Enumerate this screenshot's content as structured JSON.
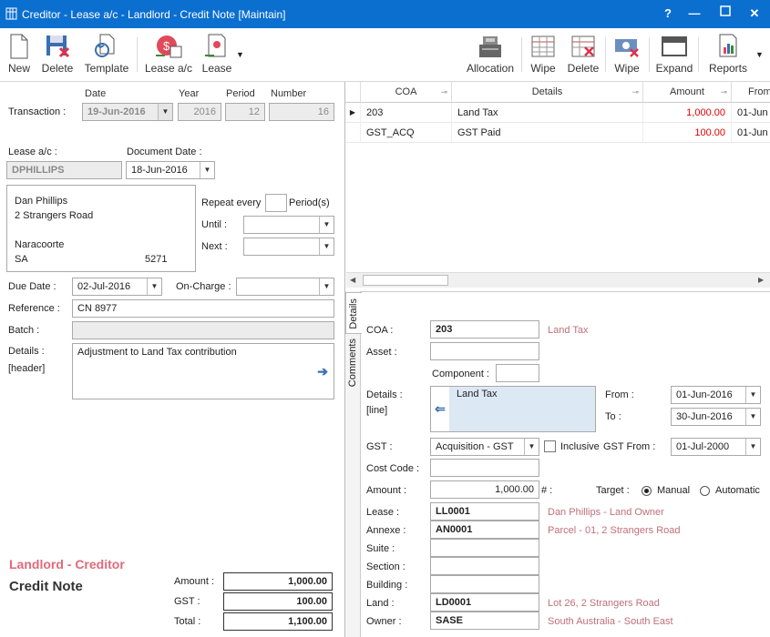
{
  "window": {
    "title": "Creditor - Lease a/c - Landlord - Credit Note [Maintain]",
    "help": "?"
  },
  "toolbar": {
    "new": "New",
    "delete": "Delete",
    "template": "Template",
    "lease_ac": "Lease a/c",
    "lease": "Lease",
    "allocation": "Allocation",
    "wipe1": "Wipe",
    "delete2": "Delete",
    "wipe2": "Wipe",
    "expand": "Expand",
    "reports": "Reports"
  },
  "transaction": {
    "label": "Transaction :",
    "date_hdr": "Date",
    "year_hdr": "Year",
    "period_hdr": "Period",
    "number_hdr": "Number",
    "date": "19-Jun-2016",
    "year": "2016",
    "period": "12",
    "number": "16"
  },
  "lease_ac": {
    "label": "Lease a/c :",
    "value": "DPHILLIPS"
  },
  "document_date": {
    "label": "Document Date :",
    "value": "18-Jun-2016"
  },
  "address": {
    "name": "Dan Phillips",
    "street": "2 Strangers Road",
    "town": "Naracoorte",
    "state": "SA",
    "postcode": "5271"
  },
  "repeat": {
    "label": "Repeat every",
    "unit": "Period(s)",
    "until_label": "Until :",
    "next_label": "Next :"
  },
  "due_date": {
    "label": "Due Date :",
    "value": "02-Jul-2016"
  },
  "on_charge": {
    "label": "On-Charge :"
  },
  "reference": {
    "label": "Reference :",
    "value": "CN 8977"
  },
  "batch": {
    "label": "Batch :"
  },
  "details": {
    "label": "Details :",
    "sublabel": "[header]",
    "value": "Adjustment to Land Tax contribution"
  },
  "footer": {
    "role": "Landlord - Creditor",
    "doc_type": "Credit Note",
    "amount_label": "Amount :",
    "amount": "1,000.00",
    "gst_label": "GST :",
    "gst": "100.00",
    "total_label": "Total :",
    "total": "1,100.00"
  },
  "grid": {
    "columns": [
      "COA",
      "Details",
      "Amount",
      "From"
    ],
    "rows": [
      {
        "coa": "203",
        "details": "Land Tax",
        "amount": "1,000.00",
        "from": "01-Jun"
      },
      {
        "coa": "GST_ACQ",
        "details": "GST Paid",
        "amount": "100.00",
        "from": "01-Jun"
      }
    ]
  },
  "side_tabs": {
    "details": "Details",
    "comments": "Comments"
  },
  "line": {
    "coa_label": "COA :",
    "coa": "203",
    "coa_desc": "Land Tax",
    "asset_label": "Asset :",
    "component_label": "Component :",
    "details_label": "Details :",
    "details_sublabel": "[line]",
    "details": "Land Tax",
    "from_label": "From :",
    "from": "01-Jun-2016",
    "to_label": "To :",
    "to": "30-Jun-2016",
    "gst_label": "GST :",
    "gst": "Acquisition - GST",
    "inclusive_label": "Inclusive",
    "gst_from_label": "GST From :",
    "gst_from": "01-Jul-2000",
    "cost_code_label": "Cost Code :",
    "amount_label": "Amount :",
    "amount": "1,000.00",
    "hash": "# :",
    "target_label": "Target :",
    "target_manual": "Manual",
    "target_automatic": "Automatic",
    "lease_label": "Lease :",
    "lease": "LL0001",
    "lease_desc": "Dan Phillips - Land Owner",
    "annexe_label": "Annexe :",
    "annexe": "AN0001",
    "annexe_desc": "Parcel - 01, 2 Strangers Road",
    "suite_label": "Suite :",
    "section_label": "Section :",
    "building_label": "Building :",
    "land_label": "Land :",
    "land": "LD0001",
    "land_desc": "Lot 26, 2 Strangers Road",
    "owner_label": "Owner :",
    "owner": "SASE",
    "owner_desc": "South Australia - South East"
  }
}
